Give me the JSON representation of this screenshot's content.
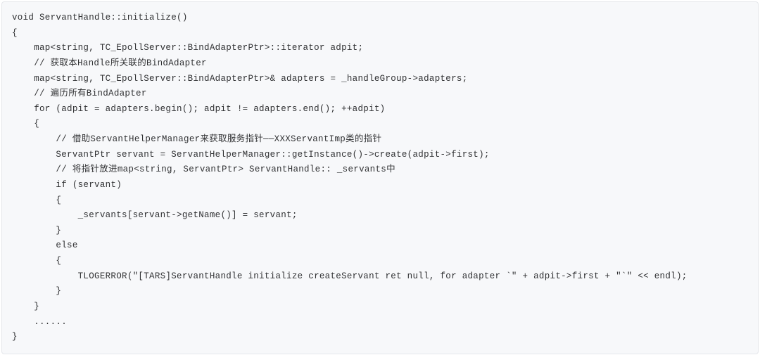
{
  "code": {
    "lines": [
      "void ServantHandle::initialize()",
      "{",
      "    map<string, TC_EpollServer::BindAdapterPtr>::iterator adpit;",
      "    // 获取本Handle所关联的BindAdapter",
      "    map<string, TC_EpollServer::BindAdapterPtr>& adapters = _handleGroup->adapters;",
      "    // 遍历所有BindAdapter",
      "    for (adpit = adapters.begin(); adpit != adapters.end(); ++adpit)",
      "    {",
      "        // 借助ServantHelperManager来获取服务指针——XXXServantImp类的指针",
      "        ServantPtr servant = ServantHelperManager::getInstance()->create(adpit->first);",
      "        // 将指针放进map<string, ServantPtr> ServantHandle:: _servants中",
      "        if (servant)",
      "        {",
      "            _servants[servant->getName()] = servant;",
      "        }",
      "        else",
      "        {",
      "            TLOGERROR(\"[TARS]ServantHandle initialize createServant ret null, for adapter `\" + adpit->first + \"`\" << endl);",
      "        }",
      "    }",
      "",
      "    ......",
      "}"
    ]
  }
}
